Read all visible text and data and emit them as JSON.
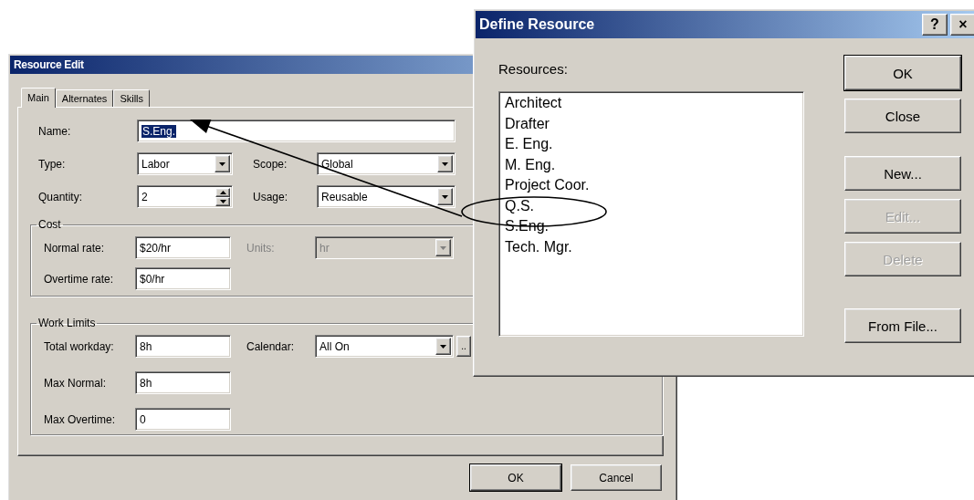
{
  "resource_edit": {
    "title": "Resource Edit",
    "tabs": [
      {
        "label": "Main",
        "selected": true
      },
      {
        "label": "Alternates",
        "selected": false
      },
      {
        "label": "Skills",
        "selected": false
      }
    ],
    "name": {
      "label": "Name:",
      "value": "S.Eng.",
      "highlighted": true
    },
    "rows": [
      [
        {
          "label": "Type:",
          "kind": "dropdown",
          "value": "Labor",
          "disabled": false
        },
        {
          "label": "Scope:",
          "kind": "dropdown",
          "value": "Global",
          "disabled": false
        }
      ],
      [
        {
          "label": "Quantity:",
          "kind": "spin",
          "value": "2",
          "disabled": false
        },
        {
          "label": "Usage:",
          "kind": "dropdown",
          "value": "Reusable",
          "disabled": false
        }
      ]
    ],
    "groups": [
      {
        "title": "Cost",
        "rows": [
          [
            {
              "label": "Normal rate:",
              "kind": "text",
              "value": "$20/hr",
              "disabled": false
            },
            {
              "label": "Units:",
              "kind": "dropdown",
              "value": "hr",
              "disabled": true
            }
          ],
          [
            {
              "label": "Overtime rate:",
              "kind": "text",
              "value": "$0/hr",
              "disabled": false
            }
          ]
        ]
      },
      {
        "title": "Work Limits",
        "rows": [
          [
            {
              "label": "Total workday:",
              "kind": "text",
              "value": "8h",
              "disabled": false
            },
            {
              "label": "Calendar:",
              "kind": "dropdown",
              "value": "All On",
              "disabled": false,
              "browse": ".."
            }
          ],
          [
            {
              "label": "Max Normal:",
              "kind": "text",
              "value": "8h",
              "disabled": false
            }
          ],
          [
            {
              "label": "Max Overtime:",
              "kind": "text",
              "value": "0",
              "disabled": false
            }
          ]
        ]
      }
    ],
    "buttons": [
      {
        "label": "OK",
        "default": true
      },
      {
        "label": "Cancel",
        "default": false
      }
    ]
  },
  "define_resource": {
    "title": "Define Resource",
    "title_buttons": [
      "?",
      "×"
    ],
    "list_label": "Resources:",
    "items": [
      {
        "label": "Architect",
        "selected": false
      },
      {
        "label": "Drafter",
        "selected": false
      },
      {
        "label": "E. Eng.",
        "selected": false
      },
      {
        "label": "M. Eng.",
        "selected": false
      },
      {
        "label": "Project Coor.",
        "selected": false
      },
      {
        "label": "Q.S.",
        "selected": false
      },
      {
        "label": "S.Eng.",
        "selected": false
      },
      {
        "label": "Tech. Mgr.",
        "selected": false
      }
    ],
    "button_groups": [
      [
        {
          "label": "OK",
          "default": true,
          "disabled": false
        },
        {
          "label": "Close",
          "default": false,
          "disabled": false
        }
      ],
      [
        {
          "label": "New...",
          "default": false,
          "disabled": false
        },
        {
          "label": "Edit...",
          "default": false,
          "disabled": true
        },
        {
          "label": "Delete",
          "default": false,
          "disabled": true
        }
      ],
      [
        {
          "label": "From File...",
          "default": false,
          "disabled": false
        }
      ]
    ]
  }
}
